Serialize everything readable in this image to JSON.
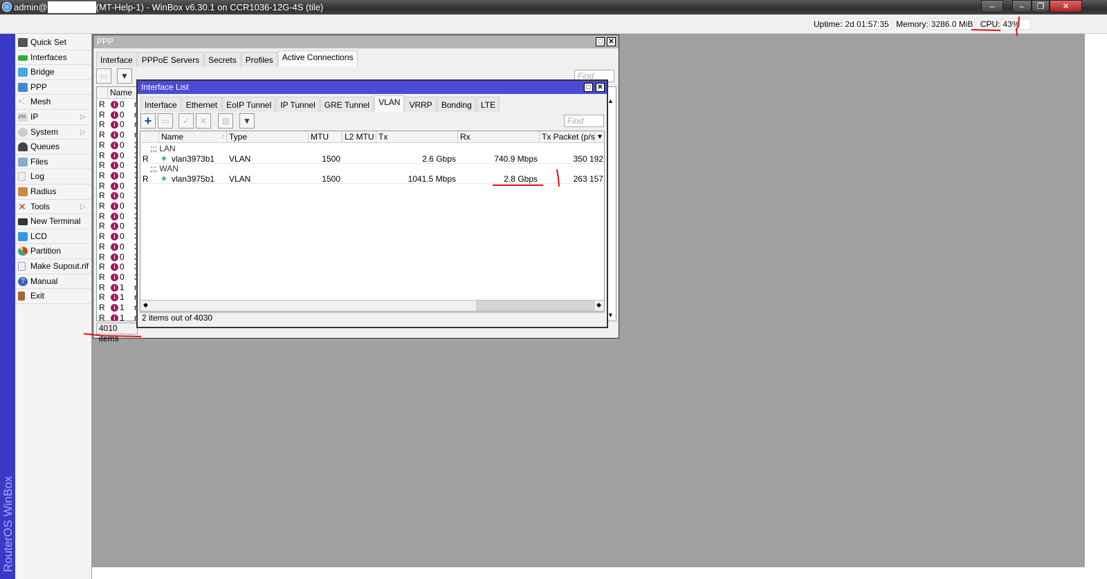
{
  "titlebar": {
    "user": "admin@",
    "title": "(MT-Help-1) - WinBox v6.30.1 on CCR1036-12G-4S (tile)"
  },
  "status": {
    "uptime_label": "Uptime:",
    "uptime": "2d 01:57:35",
    "memory_label": "Memory:",
    "memory": "3286.0 MiB",
    "cpu_label": "CPU:",
    "cpu": "43%"
  },
  "brand_vertical": "RouterOS WinBox",
  "sidebar": {
    "items": [
      {
        "label": "Quick Set"
      },
      {
        "label": "Interfaces"
      },
      {
        "label": "Bridge"
      },
      {
        "label": "PPP"
      },
      {
        "label": "Mesh"
      },
      {
        "label": "IP"
      },
      {
        "label": "System"
      },
      {
        "label": "Queues"
      },
      {
        "label": "Files"
      },
      {
        "label": "Log"
      },
      {
        "label": "Radius"
      },
      {
        "label": "Tools"
      },
      {
        "label": "New Terminal"
      },
      {
        "label": "LCD"
      },
      {
        "label": "Partition"
      },
      {
        "label": "Make Supout.rif"
      },
      {
        "label": "Manual"
      },
      {
        "label": "Exit"
      }
    ]
  },
  "ppp": {
    "title": "PPP",
    "tabs": [
      "Interface",
      "PPPoE Servers",
      "Secrets",
      "Profiles",
      "Active Connections"
    ],
    "find_placeholder": "Find",
    "column_name": "Name",
    "rows": [
      {
        "flag": "R",
        "name": "0",
        "next": "r"
      },
      {
        "flag": "R",
        "name": "0",
        "next": "r"
      },
      {
        "flag": "R",
        "name": "0",
        "next": "r"
      },
      {
        "flag": "R",
        "name": "0",
        "next": "r"
      },
      {
        "flag": "R",
        "name": "0",
        "next": "3"
      },
      {
        "flag": "R",
        "name": "0",
        "next": "3"
      },
      {
        "flag": "R",
        "name": "0",
        "next": "3"
      },
      {
        "flag": "R",
        "name": "0",
        "next": "3"
      },
      {
        "flag": "R",
        "name": "0",
        "next": "3"
      },
      {
        "flag": "R",
        "name": "0",
        "next": "3"
      },
      {
        "flag": "R",
        "name": "0",
        "next": "3"
      },
      {
        "flag": "R",
        "name": "0",
        "next": "3"
      },
      {
        "flag": "R",
        "name": "0",
        "next": "3"
      },
      {
        "flag": "R",
        "name": "0",
        "next": "3"
      },
      {
        "flag": "R",
        "name": "0",
        "next": "3"
      },
      {
        "flag": "R",
        "name": "0",
        "next": "3"
      },
      {
        "flag": "R",
        "name": "0",
        "next": "3"
      },
      {
        "flag": "R",
        "name": "0",
        "next": "3"
      },
      {
        "flag": "R",
        "name": "1",
        "next": "r"
      },
      {
        "flag": "R",
        "name": "1",
        "next": "r"
      },
      {
        "flag": "R",
        "name": "1",
        "next": "r"
      },
      {
        "flag": "R",
        "name": "1",
        "next": "r"
      }
    ],
    "status": "4010 items"
  },
  "iflist": {
    "title": "Interface List",
    "tabs": [
      "Interface",
      "Ethernet",
      "EoIP Tunnel",
      "IP Tunnel",
      "GRE Tunnel",
      "VLAN",
      "VRRP",
      "Bonding",
      "LTE"
    ],
    "active_tab": "VLAN",
    "find_placeholder": "Find",
    "columns": [
      "Name",
      "Type",
      "MTU",
      "L2 MTU",
      "Tx",
      "Rx",
      "Tx Packet (p/s)"
    ],
    "groups": [
      {
        "comment": ";;; LAN",
        "row": {
          "flag": "R",
          "name": "vlan3973b1",
          "type": "VLAN",
          "mtu": "1500",
          "l2mtu": "",
          "tx": "2.6 Gbps",
          "rx": "740.9 Mbps",
          "txp": "350 192"
        }
      },
      {
        "comment": ";;; WAN",
        "row": {
          "flag": "R",
          "name": "vlan3975b1",
          "type": "VLAN",
          "mtu": "1500",
          "l2mtu": "",
          "tx": "1041.5 Mbps",
          "rx": "2.8 Gbps",
          "txp": "263 157"
        }
      }
    ],
    "status": "2 items out of 4030"
  },
  "colors": {
    "title_blue": "#4b4bd6",
    "sidebar_strip": "#3a3ac8",
    "annotation_red": "#e01010"
  }
}
